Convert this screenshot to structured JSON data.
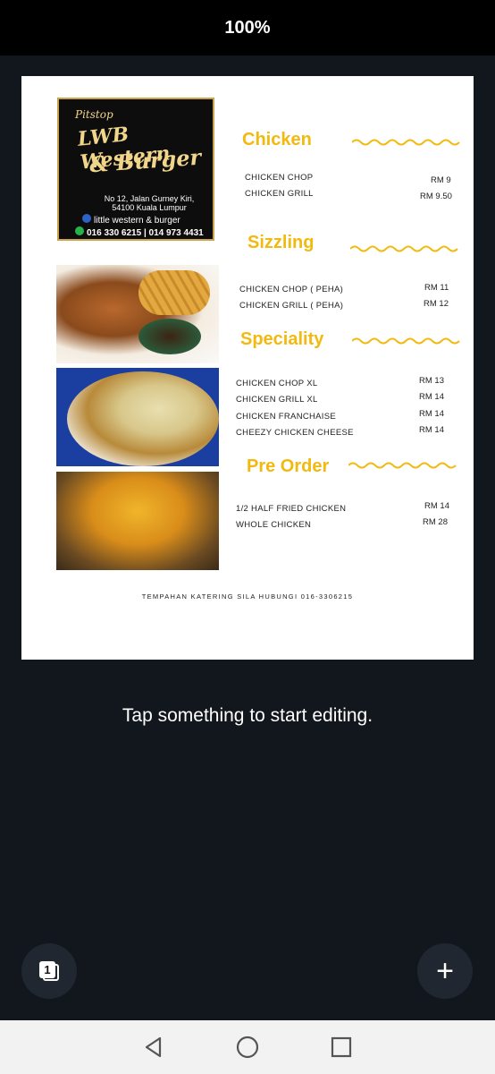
{
  "status": {
    "zoom": "100%"
  },
  "menu": {
    "logo": {
      "pitstop": "Pitstop",
      "name_line1": "LWB Western",
      "name_line2": "& Burger",
      "address1": "No 12, Jalan Gurney Kiri,",
      "address2": "54100 Kuala Lumpur",
      "facebook": "little western & burger",
      "phone": "016 330 6215 | 014 973 4431"
    },
    "sections": [
      {
        "title": "Chicken",
        "items": [
          {
            "name": "CHICKEN CHOP",
            "price": "RM 9"
          },
          {
            "name": "CHICKEN GRILL",
            "price": "RM 9.50"
          }
        ]
      },
      {
        "title": "Sizzling",
        "items": [
          {
            "name": "CHICKEN CHOP ( PEHA)",
            "price": "RM  11"
          },
          {
            "name": "CHICKEN GRILL ( PEHA)",
            "price": "RM  12"
          }
        ]
      },
      {
        "title": "Speciality",
        "items": [
          {
            "name": "CHICKEN CHOP XL",
            "price": "RM 13"
          },
          {
            "name": "CHICKEN GRILL XL",
            "price": "RM 14"
          },
          {
            "name": "CHICKEN FRANCHAISE",
            "price": "RM 14"
          },
          {
            "name": "CHEEZY CHICKEN CHEESE",
            "price": "RM 14"
          }
        ]
      },
      {
        "title": "Pre Order",
        "items": [
          {
            "name": "1/2 HALF FRIED CHICKEN",
            "price": "RM 14"
          },
          {
            "name": "WHOLE CHICKEN",
            "price": "RM 28"
          }
        ]
      }
    ],
    "caption": "TEMPAHAN KATERING SILA HUBUNGI 016-3306215"
  },
  "editor": {
    "hint": "Tap something to start editing.",
    "page_count": "1"
  },
  "colors": {
    "accent": "#f2b90f",
    "background": "#12171d"
  }
}
